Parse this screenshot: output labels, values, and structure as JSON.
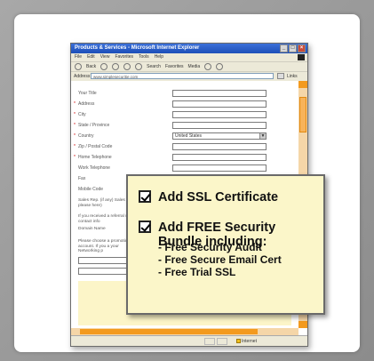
{
  "browser": {
    "title": "Products & Services - Microsoft Internet Explorer",
    "menu": [
      "File",
      "Edit",
      "View",
      "Favorites",
      "Tools",
      "Help"
    ],
    "toolbar": [
      "Back",
      "Search",
      "Favorites",
      "Media"
    ],
    "address_label": "Address",
    "address_value": "www.simplesecuritie.com",
    "links_label": "Links",
    "status_zone": "Internet"
  },
  "form": {
    "fields": [
      {
        "label": "Your Title",
        "kind": "input"
      },
      {
        "label": "Address",
        "kind": "input"
      },
      {
        "label": "City",
        "kind": "input"
      },
      {
        "label": "State / Province",
        "kind": "input"
      },
      {
        "label": "Country",
        "kind": "select",
        "value": "United States"
      },
      {
        "label": "Zip / Postal Code",
        "kind": "input"
      },
      {
        "label": "Home Telephone",
        "kind": "input"
      },
      {
        "label": "Work Telephone",
        "kind": "input"
      },
      {
        "label": "Fax",
        "kind": "input"
      },
      {
        "label": "Mobile Code",
        "kind": "input"
      }
    ],
    "sales_rep_note": "Sales Rep. (if any) Sales Rep. please here)",
    "referral_note": "If you received a referral what contact info",
    "domain_label": "Domain Name",
    "promo_note": "Please choose a promotion account. If you a your Networking p"
  },
  "callout": {
    "ssl_label": "Add SSL Certificate",
    "bundle_label_1": "Add FREE Security",
    "bundle_label_2": "Bundle including:",
    "bundle_items": [
      "- Free Security Audit",
      "- Free Secure Email Cert",
      "- Free Trial SSL"
    ],
    "ssl_checked": true,
    "bundle_checked": true
  },
  "colors": {
    "callout_bg": "#fbf6c9",
    "scrollbar_accent": "#f39a1e",
    "titlebar": "#1d4fb8"
  }
}
